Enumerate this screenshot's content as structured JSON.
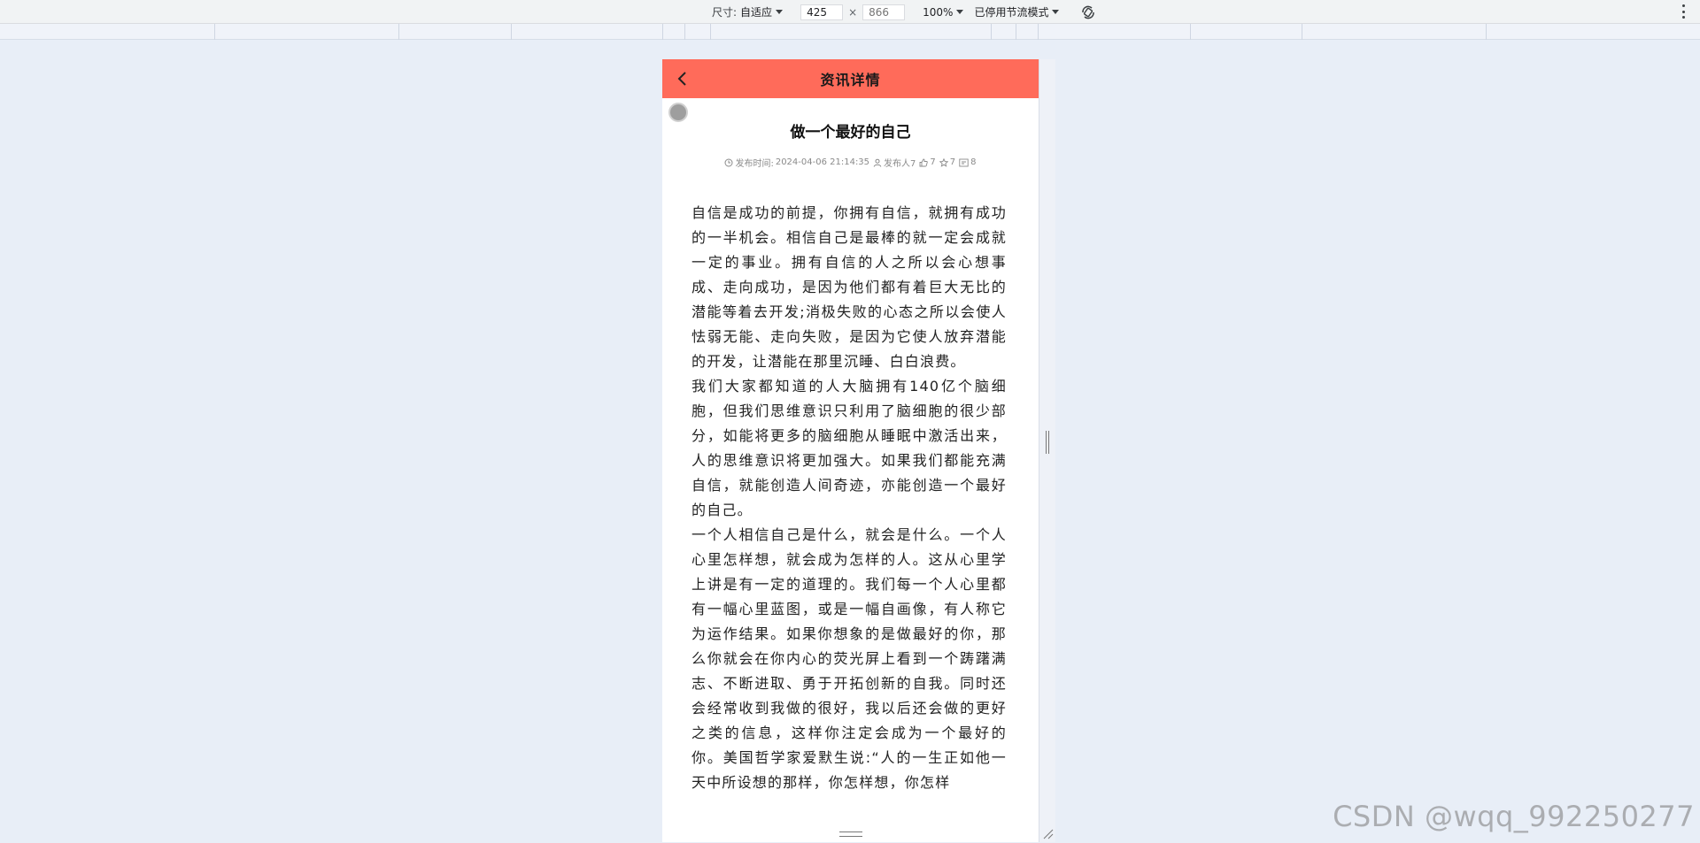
{
  "devtools": {
    "size_label": "尺寸:",
    "size_value": "自适应",
    "width_value": "425",
    "height_placeholder": "866",
    "times": "×",
    "zoom_value": "100%",
    "throttle_value": "已停用节流模式"
  },
  "app": {
    "header_title": "资讯详情"
  },
  "article": {
    "title": "做一个最好的自己",
    "meta": {
      "publish_label": "发布时间:",
      "publish_time": "2024-04-06 21:14:35",
      "author": "发布人7",
      "likes": "7",
      "favorites": "7",
      "views": "8"
    },
    "paragraphs": [
      "自信是成功的前提，你拥有自信，就拥有成功的一半机会。相信自己是最棒的就一定会成就一定的事业。拥有自信的人之所以会心想事成、走向成功，是因为他们都有着巨大无比的潜能等着去开发;消极失败的心态之所以会使人怯弱无能、走向失败，是因为它使人放弃潜能的开发，让潜能在那里沉睡、白白浪费。",
      "我们大家都知道的人大脑拥有140亿个脑细胞，但我们思维意识只利用了脑细胞的很少部分，如能将更多的脑细胞从睡眠中激活出来，人的思维意识将更加强大。如果我们都能充满自信，就能创造人间奇迹，亦能创造一个最好的自己。",
      "一个人相信自己是什么，就会是什么。一个人心里怎样想，就会成为怎样的人。这从心里学上讲是有一定的道理的。我们每一个人心里都有一幅心里蓝图，或是一幅自画像，有人称它为运作结果。如果你想象的是做最好的你，那么你就会在你内心的荧光屏上看到一个踌躇满志、不断进取、勇于开拓创新的自我。同时还会经常收到我做的很好，我以后还会做的更好之类的信息，这样你注定会成为一个最好的你。美国哲学家爱默生说:“人的一生正如他一天中所设想的那样，你怎样想，你怎样"
    ]
  },
  "watermark": "CSDN @wqq_992250277",
  "colors": {
    "header_bg": "#ff6b5a",
    "page_bg": "#e8eef7"
  }
}
